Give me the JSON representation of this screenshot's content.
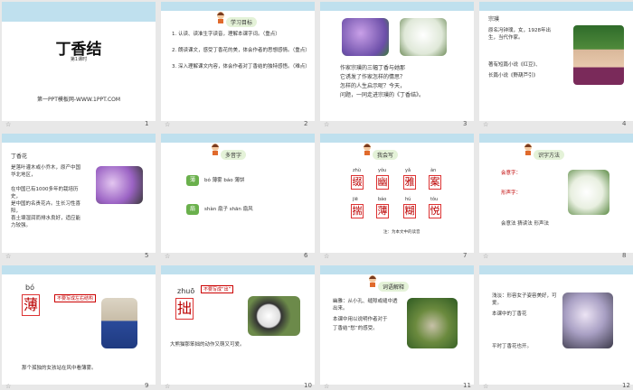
{
  "slides": [
    {
      "num": "1",
      "title": "丁香结",
      "sub": "第1课时",
      "footer": "第一PPT模板网-WWW.1PPT.COM"
    },
    {
      "num": "2",
      "head": "学习目标",
      "lines": [
        "1. 认读、读准生字读音，理解本课字词。（重点）",
        "2. 朗读课文，感受丁香花的美，体会作者的思想感情。（重点）",
        "3. 深入理解课文内容，体会作者对丁香结的独特感悟。（难点）"
      ]
    },
    {
      "num": "3",
      "body": [
        "作家宗璞的三幅丁香与她那",
        "它诱发了作家怎样的情思？",
        "怎样的人生启示呢？今天，",
        "问题，一同走进宗璞的《丁香结》。"
      ]
    },
    {
      "num": "4",
      "head": "宗璞",
      "body": [
        "原名冯钟璞，女，1928年出生，当代作家。",
        "著有短篇小说《红豆》、",
        "长篇小说《野葫芦引》"
      ]
    },
    {
      "num": "5",
      "head": "丁香花",
      "body": [
        "是落叶灌木或小乔木，原产中国华北地区，",
        "在中国已有1000多年的栽培历史，",
        "是中国的名贵花卉。生长习性喜阳，",
        "喜土壤湿润而排水良好，适应能力较强。"
      ]
    },
    {
      "num": "6",
      "head": "多音字",
      "rows": [
        {
          "ch": "薄",
          "txt": "bó 薄雾 báo 薄饼"
        },
        {
          "ch": "扇",
          "txt": "shàn 扇子 shān 扇风"
        }
      ]
    },
    {
      "num": "7",
      "head": "我会写",
      "pinyin": [
        "zhù",
        "yǒu",
        "yǎ",
        "àn",
        "jiē",
        "báo",
        "hú",
        "tǒu"
      ],
      "chars": [
        "缀",
        "幽",
        "雅",
        "案",
        "揣",
        "薄",
        "糊",
        "悦"
      ],
      "note": "注：为本文中的读音"
    },
    {
      "num": "8",
      "head": "识字方法",
      "body": [
        "会意字：",
        "形声字：",
        "会意法 猜读法 形声法"
      ]
    },
    {
      "num": "9",
      "py": "bó",
      "char": "薄",
      "label": "不要写成左右结构",
      "cap": "那个孤独的女孩站在风中看薄雾。"
    },
    {
      "num": "10",
      "py": "zhuō",
      "char": "拙",
      "label": "不要写成“出”",
      "cap": "大熊猫那笨拙的动作又萌又可爱。"
    },
    {
      "num": "11",
      "head": "词语解释",
      "body": [
        "幽雅：从小孔、缝隙或缝中透出来。",
        "本课中用以说明作者对于",
        "丁香结“愁”的感受。"
      ]
    },
    {
      "num": "12",
      "body": [
        "浅淡：形容女子姿容美好，可爱。",
        "本课中的丁香花",
        "平时丁香花也开。"
      ]
    }
  ],
  "colors": {
    "band": "#bfe0ee",
    "accent": "#c00000",
    "green": "#6ab04c"
  }
}
